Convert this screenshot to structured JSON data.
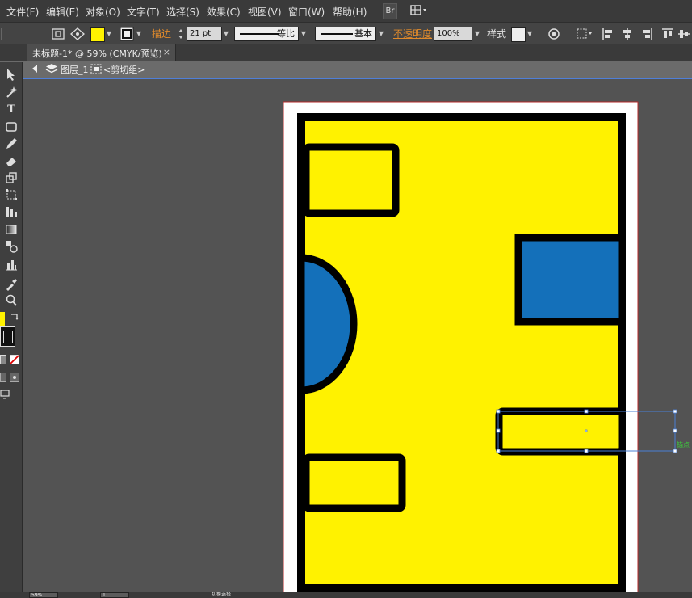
{
  "menu": {
    "items": [
      "文件(F)",
      "编辑(E)",
      "对象(O)",
      "文字(T)",
      "选择(S)",
      "效果(C)",
      "视图(V)",
      "窗口(W)",
      "帮助(H)"
    ],
    "bridge_label": "Br",
    "workspace_icon": "workspace-grid-icon"
  },
  "control": {
    "fill_color": "#FFF200",
    "stroke_label": "描边",
    "stroke_weight": "21 pt",
    "profile_label": "等比",
    "brush_label": "基本",
    "opacity_label": "不透明度",
    "opacity_value": "100%",
    "style_label": "样式"
  },
  "document": {
    "tab_title": "未标题-1* @ 59% (CMYK/预览)",
    "tab_close": "×",
    "breadcrumb_layer": "图层_1",
    "breadcrumb_group": "<剪切组>"
  },
  "artwork": {
    "background_color": "#FFF200",
    "outline_color": "#000000",
    "shape_color": "#1470BA",
    "selection_color": "#4A7FD6",
    "anchor_hint": "锚点"
  },
  "status": {
    "zoom": "59%",
    "page": "1",
    "tool_status": "切换选择"
  },
  "colors": {
    "menubar_bg": "#3A3A3A",
    "panel_bg": "#444444",
    "canvas_bg": "#535353",
    "accent_orange": "#E08A2B"
  }
}
